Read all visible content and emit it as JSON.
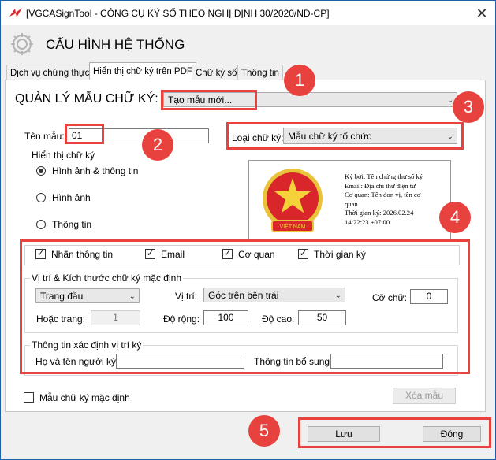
{
  "window": {
    "title": "[VGCASignTool - CÔNG CỤ KÝ SỐ THEO NGHỊ ĐỊNH 30/2020/NĐ-CP]",
    "close_glyph": "✕"
  },
  "header": {
    "title": "CẤU HÌNH HỆ THỐNG"
  },
  "tabs": [
    {
      "label": "Dịch vụ chứng thực"
    },
    {
      "label": "Hiển thị chữ ký trên PDF"
    },
    {
      "label": "Chữ ký số"
    },
    {
      "label": "Thông tin"
    }
  ],
  "template_manager": {
    "label": "QUẢN LÝ MẪU CHỮ KÝ:",
    "selected": "Tạo mẫu mới..."
  },
  "template_name": {
    "label": "Tên mẫu:",
    "value": "01"
  },
  "signature_type": {
    "label": "Loại chữ ký:",
    "selected": "Mẫu chữ ký tổ chức"
  },
  "display_group": {
    "title": "Hiển thị chữ ký",
    "options": [
      {
        "label": "Hình ảnh & thông tin",
        "selected": true
      },
      {
        "label": "Hình ảnh",
        "selected": false
      },
      {
        "label": "Thông tin",
        "selected": false
      }
    ]
  },
  "preview": {
    "lines": [
      "Ký bởi: Tên chứng thư số ký",
      "Email: Địa chỉ thư điện tử",
      "Cơ quan: Tên đơn vị, tên cơ",
      "quan",
      "Thời gian ký: 2026.02.24",
      "14:22:23 +07:00"
    ],
    "emblem_text": "VIỆT NAM"
  },
  "info_checks": [
    {
      "label": "Nhãn thông tin",
      "checked": true
    },
    {
      "label": "Email",
      "checked": true
    },
    {
      "label": "Cơ quan",
      "checked": true
    },
    {
      "label": "Thời gian ký",
      "checked": true
    }
  ],
  "check_glyph": "✓",
  "position_group": {
    "title": "Vị trí  & Kích thước chữ ký mặc định",
    "page_selected": "Trang đầu",
    "position_label": "Vị trí:",
    "position_selected": "Góc trên bên trái",
    "font_size_label": "Cỡ chữ:",
    "font_size_value": "0",
    "or_page_label": "Hoặc trang:",
    "or_page_value": "1",
    "width_label": "Độ rộng:",
    "width_value": "100",
    "height_label": "Độ cao:",
    "height_value": "50"
  },
  "identify_group": {
    "title": "Thông tin xác định vị trí ký",
    "signer_label": "Họ và tên người ký:",
    "signer_value": "",
    "extra_label": "Thông tin bổ sung:",
    "extra_value": ""
  },
  "default_template": {
    "label": "Mẫu chữ ký mặc định",
    "checked": false
  },
  "delete_button": "Xóa mẫu",
  "footer": {
    "save": "Lưu",
    "close": "Đóng"
  },
  "callouts": [
    "1",
    "2",
    "3",
    "4",
    "5"
  ],
  "colors": {
    "callout": "#e8423e",
    "border": "#1f5fa8"
  }
}
